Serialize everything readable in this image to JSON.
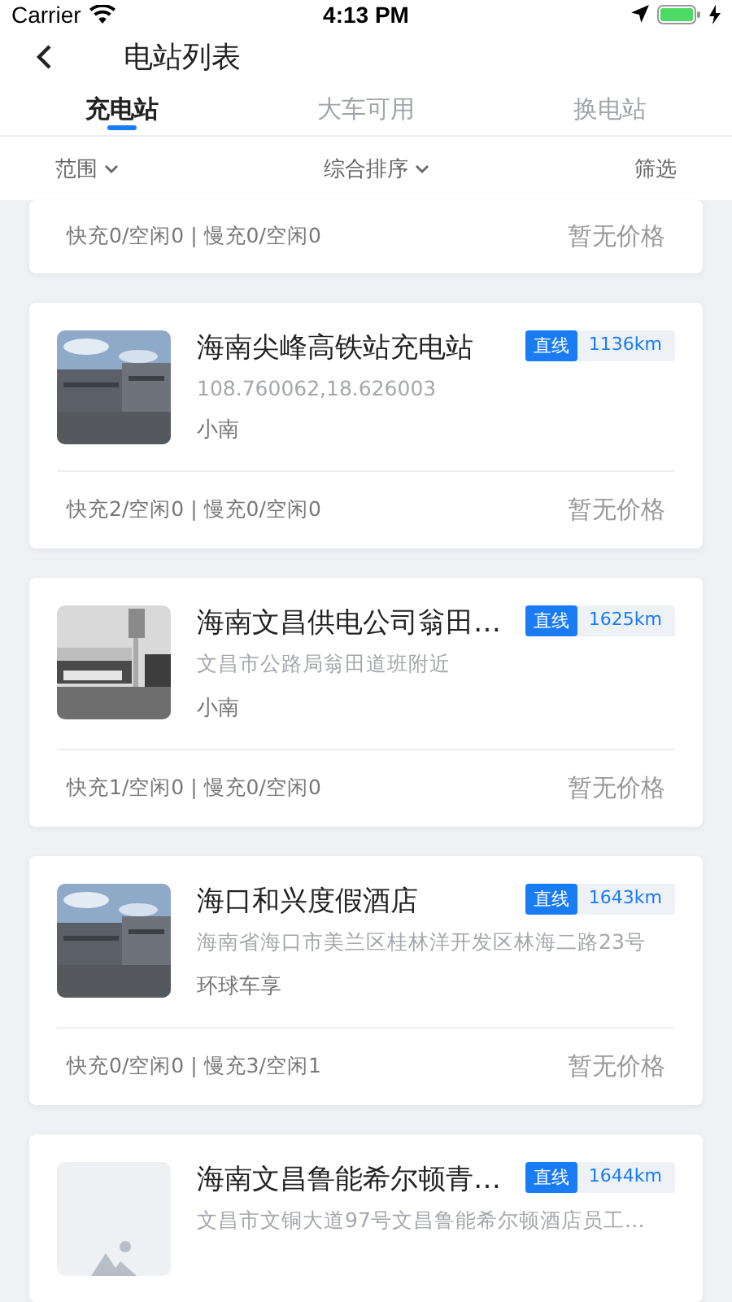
{
  "status_bar": {
    "carrier": "Carrier",
    "time": "4:13 PM"
  },
  "nav": {
    "title": "电站列表"
  },
  "tabs": [
    {
      "label": "充电站",
      "selected": true
    },
    {
      "label": "大车可用",
      "selected": false
    },
    {
      "label": "换电站",
      "selected": false
    }
  ],
  "filters": [
    {
      "label": "范围",
      "dropdown": true
    },
    {
      "label": "综合排序",
      "dropdown": true
    },
    {
      "label": "筛选",
      "dropdown": false
    }
  ],
  "stations": [
    {
      "kind": "partial",
      "chargers": "快充0/空闲0 | 慢充0/空闲0",
      "price": "暂无价格"
    },
    {
      "kind": "full",
      "photo": true,
      "name": "海南尖峰高铁站充电站",
      "tag": "直线",
      "distance": "1136km",
      "address": "108.760062,18.626003",
      "operator": "小南",
      "chargers": "快充2/空闲0 | 慢充0/空闲0",
      "price": "暂无价格"
    },
    {
      "kind": "full",
      "photo": true,
      "name": "海南文昌供电公司翁田…",
      "tag": "直线",
      "distance": "1625km",
      "address": "文昌市公路局翁田道班附近",
      "operator": "小南",
      "chargers": "快充1/空闲0 | 慢充0/空闲0",
      "price": "暂无价格"
    },
    {
      "kind": "full",
      "photo": true,
      "name": "海口和兴度假酒店",
      "tag": "直线",
      "distance": "1643km",
      "address": "海南省海口市美兰区桂林洋开发区林海二路23号",
      "operator": "环球车享",
      "chargers": "快充0/空闲0 | 慢充3/空闲1",
      "price": "暂无价格"
    },
    {
      "kind": "full",
      "photo": false,
      "name": "海南文昌鲁能希尔顿青…",
      "tag": "直线",
      "distance": "1644km",
      "address": "文昌市文铜大道97号文昌鲁能希尔顿酒店员工…"
    }
  ]
}
